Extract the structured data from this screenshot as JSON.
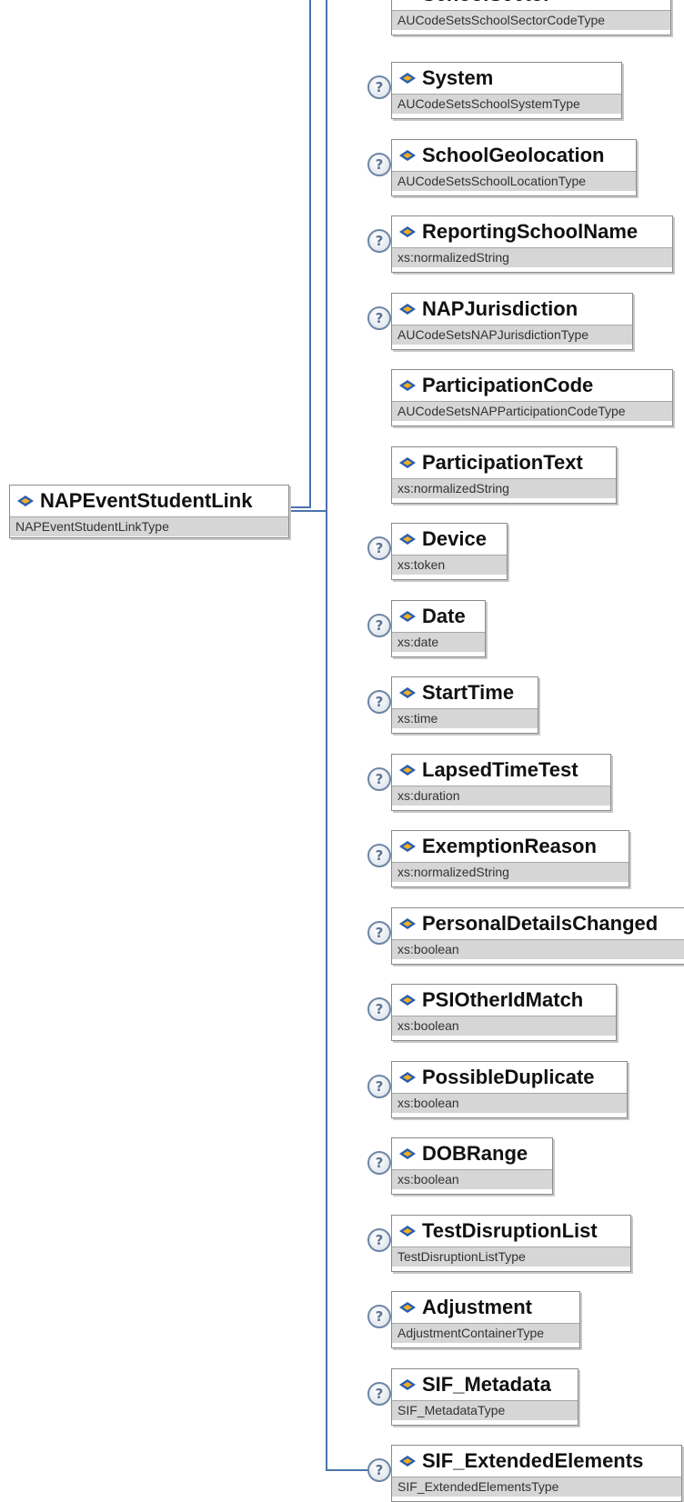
{
  "root": {
    "name": "NAPEventStudentLink",
    "type": "NAPEventStudentLinkType"
  },
  "children": [
    {
      "name": "SchoolSector",
      "type": "AUCodeSetsSchoolSectorCodeType",
      "optional": false
    },
    {
      "name": "System",
      "type": "AUCodeSetsSchoolSystemType",
      "optional": true
    },
    {
      "name": "SchoolGeolocation",
      "type": "AUCodeSetsSchoolLocationType",
      "optional": true
    },
    {
      "name": "ReportingSchoolName",
      "type": "xs:normalizedString",
      "optional": true
    },
    {
      "name": "NAPJurisdiction",
      "type": "AUCodeSetsNAPJurisdictionType",
      "optional": true
    },
    {
      "name": "ParticipationCode",
      "type": "AUCodeSetsNAPParticipationCodeType",
      "optional": false
    },
    {
      "name": "ParticipationText",
      "type": "xs:normalizedString",
      "optional": false
    },
    {
      "name": "Device",
      "type": "xs:token",
      "optional": true
    },
    {
      "name": "Date",
      "type": "xs:date",
      "optional": true
    },
    {
      "name": "StartTime",
      "type": "xs:time",
      "optional": true
    },
    {
      "name": "LapsedTimeTest",
      "type": "xs:duration",
      "optional": true
    },
    {
      "name": "ExemptionReason",
      "type": "xs:normalizedString",
      "optional": true
    },
    {
      "name": "PersonalDetailsChanged",
      "type": "xs:boolean",
      "optional": true
    },
    {
      "name": "PSIOtherIdMatch",
      "type": "xs:boolean",
      "optional": true
    },
    {
      "name": "PossibleDuplicate",
      "type": "xs:boolean",
      "optional": true
    },
    {
      "name": "DOBRange",
      "type": "xs:boolean",
      "optional": true
    },
    {
      "name": "TestDisruptionList",
      "type": "TestDisruptionListType",
      "optional": true
    },
    {
      "name": "Adjustment",
      "type": "AdjustmentContainerType",
      "optional": true
    },
    {
      "name": "SIF_Metadata",
      "type": "SIF_MetadataType",
      "optional": true
    },
    {
      "name": "SIF_ExtendedElements",
      "type": "SIF_ExtendedElementsType",
      "optional": true
    }
  ],
  "optional_symbol": "?",
  "colors": {
    "connector": "#4a73ac",
    "icon_blue": "#2a5db0",
    "icon_gold": "#f0b020"
  }
}
